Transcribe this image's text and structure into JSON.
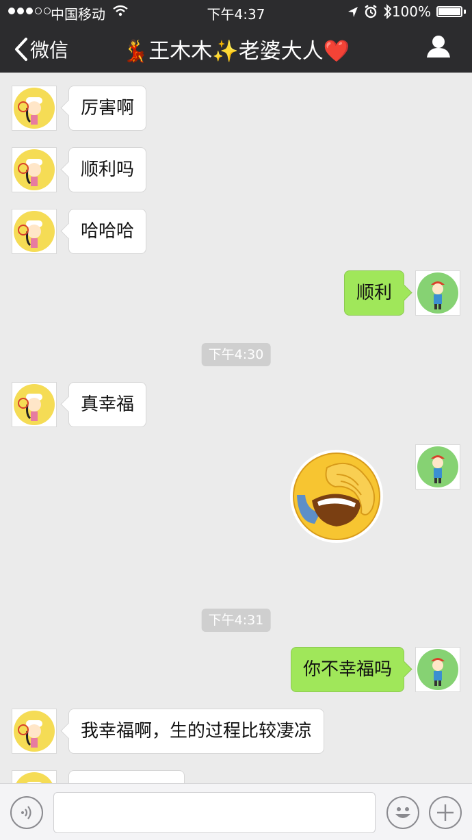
{
  "status_bar": {
    "signal_bars": 5,
    "signal_filled": 3,
    "carrier": "中国移动",
    "time": "下午4:37",
    "battery": "100%",
    "icons": [
      "wifi-icon",
      "location-arrow-icon",
      "alarm-icon",
      "bluetooth-icon",
      "battery-icon"
    ]
  },
  "nav": {
    "back_label": "微信",
    "title": "💃王木木✨老婆大人❤️",
    "profile_icon": "person-icon"
  },
  "messages": [
    {
      "type": "text",
      "from": "her",
      "text": "厉害啊"
    },
    {
      "type": "text",
      "from": "her",
      "text": "顺利吗"
    },
    {
      "type": "text",
      "from": "her",
      "text": "哈哈哈"
    },
    {
      "type": "text",
      "from": "me",
      "text": "顺利"
    },
    {
      "type": "time",
      "text": "下午4:30"
    },
    {
      "type": "text",
      "from": "her",
      "text": "真幸福"
    },
    {
      "type": "sticker",
      "from": "me",
      "sticker": "facepalm-laughing-emoji"
    },
    {
      "type": "time",
      "text": "下午4:31"
    },
    {
      "type": "text",
      "from": "me",
      "text": "你不幸福吗"
    },
    {
      "type": "text",
      "from": "her",
      "text": "我幸福啊，生的过程比较凄凉"
    },
    {
      "type": "text",
      "from": "her",
      "text": ""
    }
  ],
  "input_bar": {
    "voice_icon": "voice-icon",
    "emoji_icon": "smiley-icon",
    "plus_icon": "plus-icon"
  },
  "colors": {
    "bar_bg": "#2c2c2e",
    "chat_bg": "#ebebeb",
    "bubble_out": "#a0e75a",
    "bubble_in": "#ffffff"
  }
}
